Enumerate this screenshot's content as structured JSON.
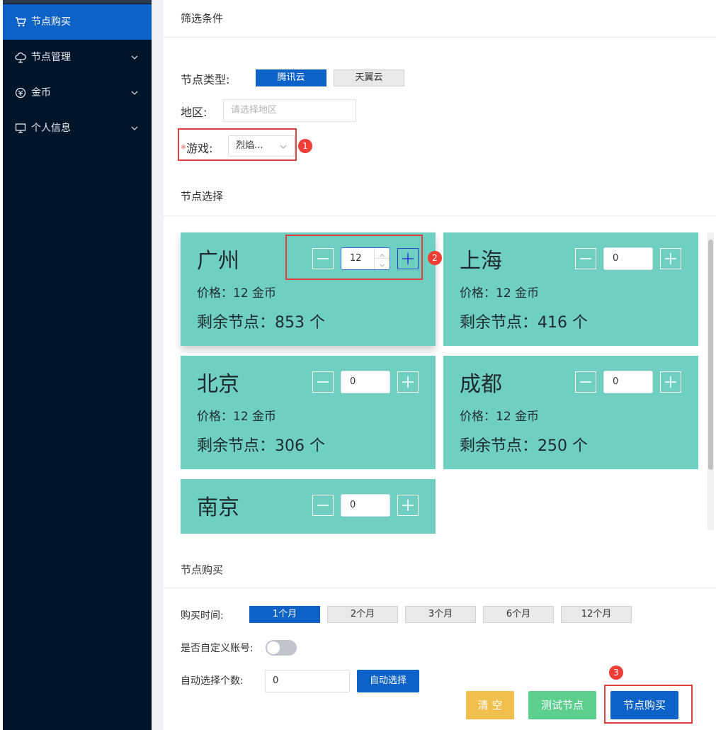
{
  "sidebar": {
    "items": [
      {
        "label": "节点购买",
        "icon": "cart-icon",
        "active": true
      },
      {
        "label": "节点管理",
        "icon": "cloud-node-icon"
      },
      {
        "label": "金币",
        "icon": "coin-icon"
      },
      {
        "label": "个人信息",
        "icon": "monitor-icon"
      }
    ]
  },
  "filter": {
    "title": "筛选条件",
    "node_type_label": "节点类型:",
    "node_types": [
      "腾讯云",
      "天翼云"
    ],
    "region_label": "地区:",
    "region_placeholder": "请选择地区",
    "game_required_mark": "*",
    "game_label": "游戏:",
    "game_value": "烈焰...",
    "badge": "1"
  },
  "node_select": {
    "title": "节点选择",
    "badge": "2",
    "cards": [
      {
        "city": "广州",
        "price": "价格：12 金币",
        "remaining": "剩余节点：853 个",
        "qty": "12"
      },
      {
        "city": "上海",
        "price": "价格：12 金币",
        "remaining": "剩余节点：416 个",
        "qty": "0"
      },
      {
        "city": "北京",
        "price": "价格：12 金币",
        "remaining": "剩余节点：306 个",
        "qty": "0"
      },
      {
        "city": "成都",
        "price": "价格：12 金币",
        "remaining": "剩余节点：250 个",
        "qty": "0"
      },
      {
        "city": "南京",
        "price": "",
        "remaining": "",
        "qty": "0"
      }
    ]
  },
  "purchase": {
    "title": "节点购买",
    "duration_label": "购买时间:",
    "durations": [
      "1个月",
      "2个月",
      "3个月",
      "6个月",
      "12个月"
    ],
    "custom_account_label": "是否自定义账号:",
    "auto_count_label": "自动选择个数:",
    "auto_count_value": "0",
    "auto_select_button": "自动选择",
    "clear_button": "清 空",
    "test_button": "测试节点",
    "buy_button": "节点购买",
    "badge": "3"
  },
  "colors": {
    "sidebar_bg": "#001529",
    "primary": "#0d62c7",
    "card_bg": "#6fd0c2",
    "warning": "#f0c04e",
    "success": "#5ccf8f",
    "highlight_border": "#e0413e"
  }
}
